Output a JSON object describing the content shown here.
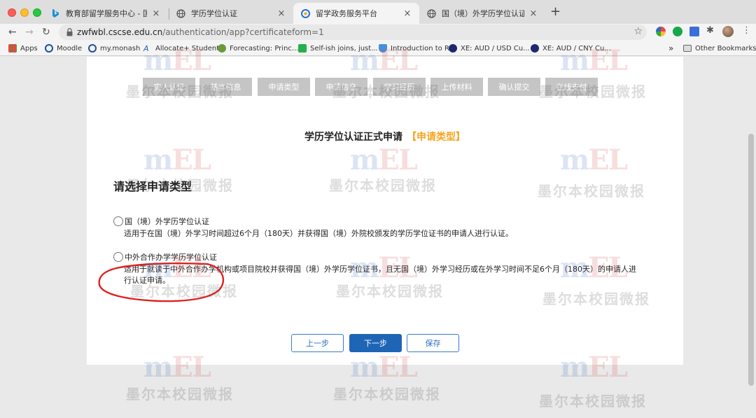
{
  "browser": {
    "tabs": [
      {
        "title": "教育部留学服务中心 - 国内版 Bi",
        "active": false,
        "icon": "bing-icon"
      },
      {
        "title": "学历学位认证",
        "active": false,
        "icon": "globe-icon"
      },
      {
        "title": "留学政务服务平台",
        "active": true,
        "icon": "site-icon"
      },
      {
        "title": "国（境）外学历学位认证申请材",
        "active": false,
        "icon": "globe-icon"
      }
    ],
    "url_host": "zwfwbl.cscse.edu.cn",
    "url_path": "/authentication/app?certificateform=1",
    "bookmarks": [
      "Apps",
      "Moodle",
      "my.monash",
      "Allocate+ Student",
      "Forecasting: Princ...",
      "Self-ish joins, just...",
      "Introduction to R",
      "XE: AUD / USD Cu...",
      "XE: AUD / CNY Cu..."
    ],
    "other_bookmarks": "Other Bookmarks",
    "overflow": "»"
  },
  "steps": [
    "实人认证",
    "基本信息",
    "申请类型",
    "申请信息",
    "学习经历",
    "上传材料",
    "确认提交",
    "在线支付"
  ],
  "page": {
    "title": "学历学位认证正式申请",
    "title_tag": "【申请类型】",
    "section_title": "请选择申请类型"
  },
  "options": [
    {
      "title": "国（境）外学历学位认证",
      "description": "适用于在国（境）外学习时间超过6个月（180天）并获得国（境）外院校颁发的学历学位证书的申请人进行认证。",
      "selected": false
    },
    {
      "title": "中外合作办学学历学位认证",
      "description": "适用于就读于中外合作办学机构或项目院校并获得国（境）外学历学位证书，且无国（境）外学习经历或在外学习时间不足6个月（180天）的申请人进行认证申请。",
      "selected": false
    }
  ],
  "buttons": {
    "prev": "上一步",
    "next": "下一步",
    "save": "保存"
  },
  "watermark": {
    "logo_m": "m",
    "logo_el": "EL",
    "text": "墨尔本校园微报"
  },
  "colors": {
    "accent": "#f5a623",
    "primary": "#1f65b5",
    "annotation": "#e02020"
  }
}
